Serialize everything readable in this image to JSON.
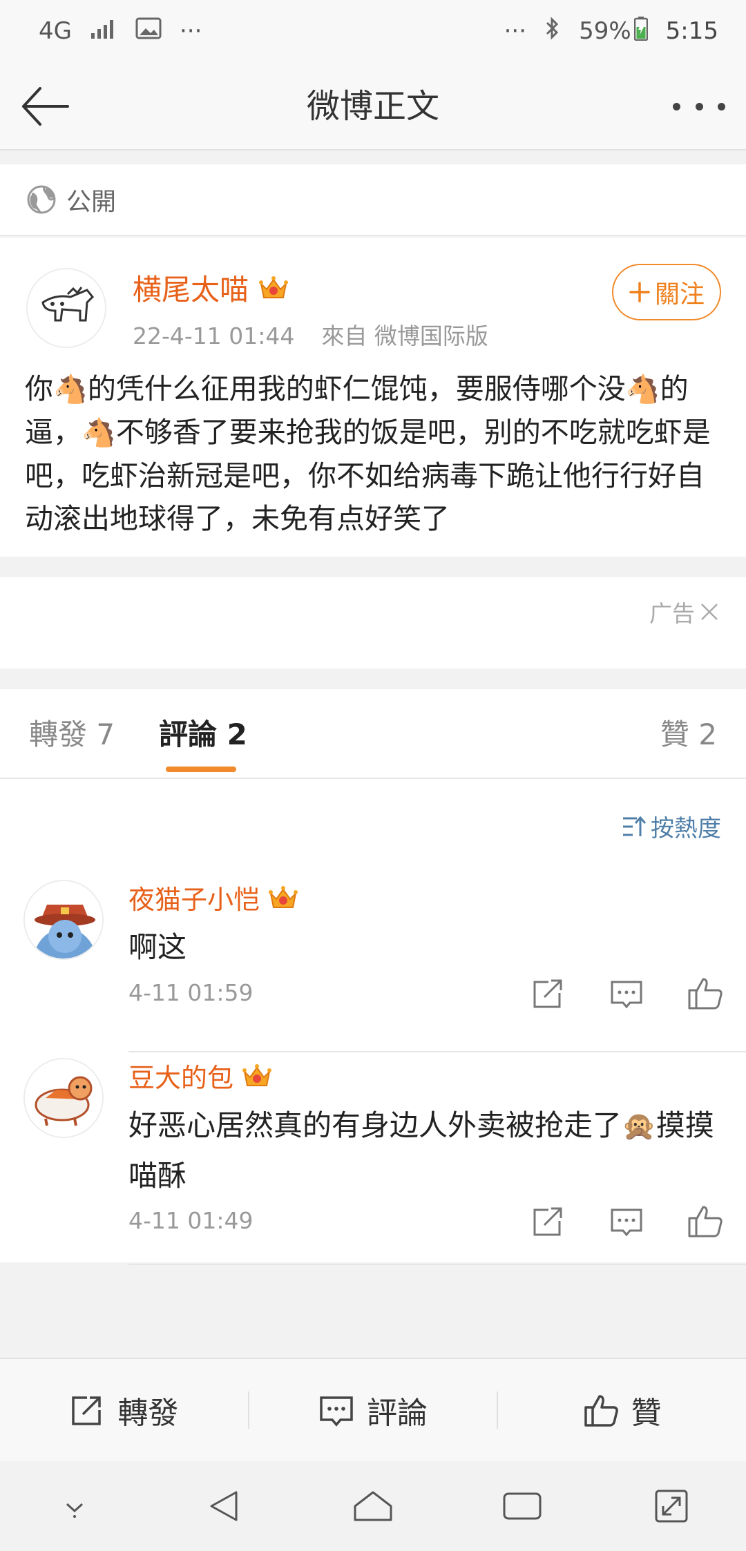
{
  "status_bar": {
    "network": "4G",
    "more": "···",
    "battery": "59%",
    "time": "5:15"
  },
  "header": {
    "title": "微博正文"
  },
  "visibility": {
    "label": "公開"
  },
  "post": {
    "author": "横尾太喵",
    "timestamp": "22-4-11 01:44",
    "source": "來自 微博国际版",
    "follow_label": "關注",
    "text_parts": [
      "你",
      "🐴",
      "的凭什么征用我的虾仁馄饨，要服侍哪个没",
      "🐴",
      "的逼，",
      "🐴",
      "不够香了要来抢我的饭是吧，别的不吃就吃虾是吧，吃虾治新冠是吧，你不如给病毒下跪让他行行好自动滚出地球得了，未免有点好笑了"
    ]
  },
  "ad": {
    "label": "广告"
  },
  "tabs": {
    "repost": "轉發 7",
    "comments": "評論 2",
    "likes": "贊 2"
  },
  "sort": {
    "label": "按熱度"
  },
  "comments": [
    {
      "name": "夜猫子小恺",
      "text": "啊这",
      "time": "4-11 01:59"
    },
    {
      "name": "豆大的包",
      "text_before": "好恶心居然真的有身边人外卖被抢走了",
      "emoji": "🙊",
      "text_after": "摸摸喵酥",
      "time": "4-11 01:49"
    }
  ],
  "bottom_bar": {
    "repost": "轉發",
    "comment": "評論",
    "like": "贊"
  },
  "colors": {
    "accent": "#f08a2a",
    "username": "#e8611a",
    "link": "#4f7fa8"
  }
}
